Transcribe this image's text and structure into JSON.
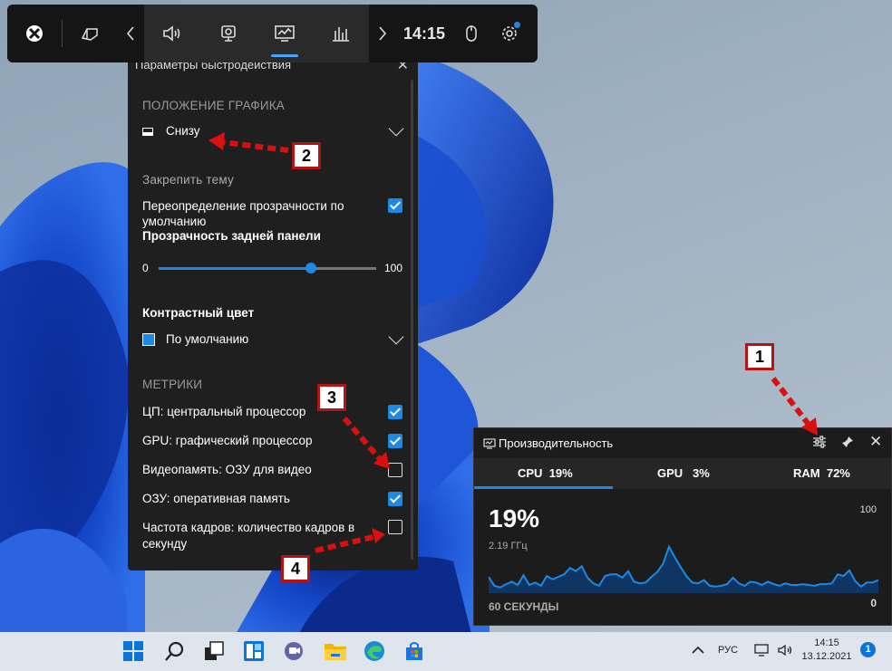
{
  "gamebar": {
    "clock": "14:15",
    "icons": [
      "xbox-icon",
      "widget-menu-icon",
      "chevron-left-icon",
      "audio-icon",
      "capture-icon",
      "performance-icon",
      "resources-icon",
      "chevron-right-icon",
      "mouse-icon",
      "settings-icon"
    ]
  },
  "settings_panel": {
    "title": "Параметры быстродействия",
    "graph_position_section": "ПОЛОЖЕНИЕ ГРАФИКА",
    "graph_position_value": "Снизу",
    "pin_theme_section": "Закрепить тему",
    "transparency_override_label": "Переопределение прозрачности по умолчанию",
    "transparency_override_checked": true,
    "backplate_transparency_label": "Прозрачность задней панели",
    "slider_min": "0",
    "slider_max": "100",
    "slider_value": 70,
    "accent_color_label": "Контрастный цвет",
    "accent_color_value": "По умолчанию",
    "accent_color_swatch": "#1e88e5",
    "metrics_section": "МЕТРИКИ",
    "metrics": [
      {
        "label": "ЦП: центральный процессор",
        "checked": true
      },
      {
        "label": "GPU: графический процессор",
        "checked": true
      },
      {
        "label": "Видеопамять: ОЗУ для видео",
        "checked": false
      },
      {
        "label": "ОЗУ: оперативная память",
        "checked": true
      },
      {
        "label": "Частота кадров: количество кадров в секунду",
        "checked": false
      }
    ]
  },
  "performance": {
    "title": "Производительность",
    "tabs": [
      {
        "name": "CPU",
        "value": "19%"
      },
      {
        "name": "GPU",
        "value": "3%"
      },
      {
        "name": "RAM",
        "value": "72%"
      }
    ],
    "big_value": "19%",
    "frequency": "2.19 ГГц",
    "axis_max": "100",
    "axis_min": "0",
    "time_window": "60 СЕКУНДЫ",
    "accent": "#1e88e5"
  },
  "chart_data": {
    "type": "area",
    "ylim": [
      0,
      100
    ],
    "series": [
      {
        "values": [
          20,
          9,
          7,
          11,
          14,
          10,
          22,
          10,
          13,
          9,
          21,
          17,
          20,
          23,
          31,
          27,
          33,
          19,
          12,
          9,
          21,
          23,
          23,
          19,
          27,
          14,
          12,
          13,
          20,
          26,
          36,
          57,
          44,
          32,
          21,
          13,
          12,
          16,
          9,
          8,
          9,
          11,
          19,
          12,
          9,
          14,
          13,
          10,
          14,
          11,
          9,
          12,
          10,
          10,
          11,
          10,
          9,
          11,
          11,
          12,
          23,
          21,
          28,
          15,
          8,
          13,
          13,
          16
        ]
      }
    ]
  },
  "taskbar": {
    "icons": [
      "windows-start-icon",
      "search-icon",
      "task-view-icon",
      "widgets-icon",
      "teams-chat-icon",
      "file-explorer-icon",
      "edge-icon",
      "store-icon"
    ],
    "lang": "РУС",
    "time": "14:15",
    "date": "13.12.2021",
    "notifications": "1"
  },
  "annotations": [
    "1",
    "2",
    "3",
    "4"
  ]
}
